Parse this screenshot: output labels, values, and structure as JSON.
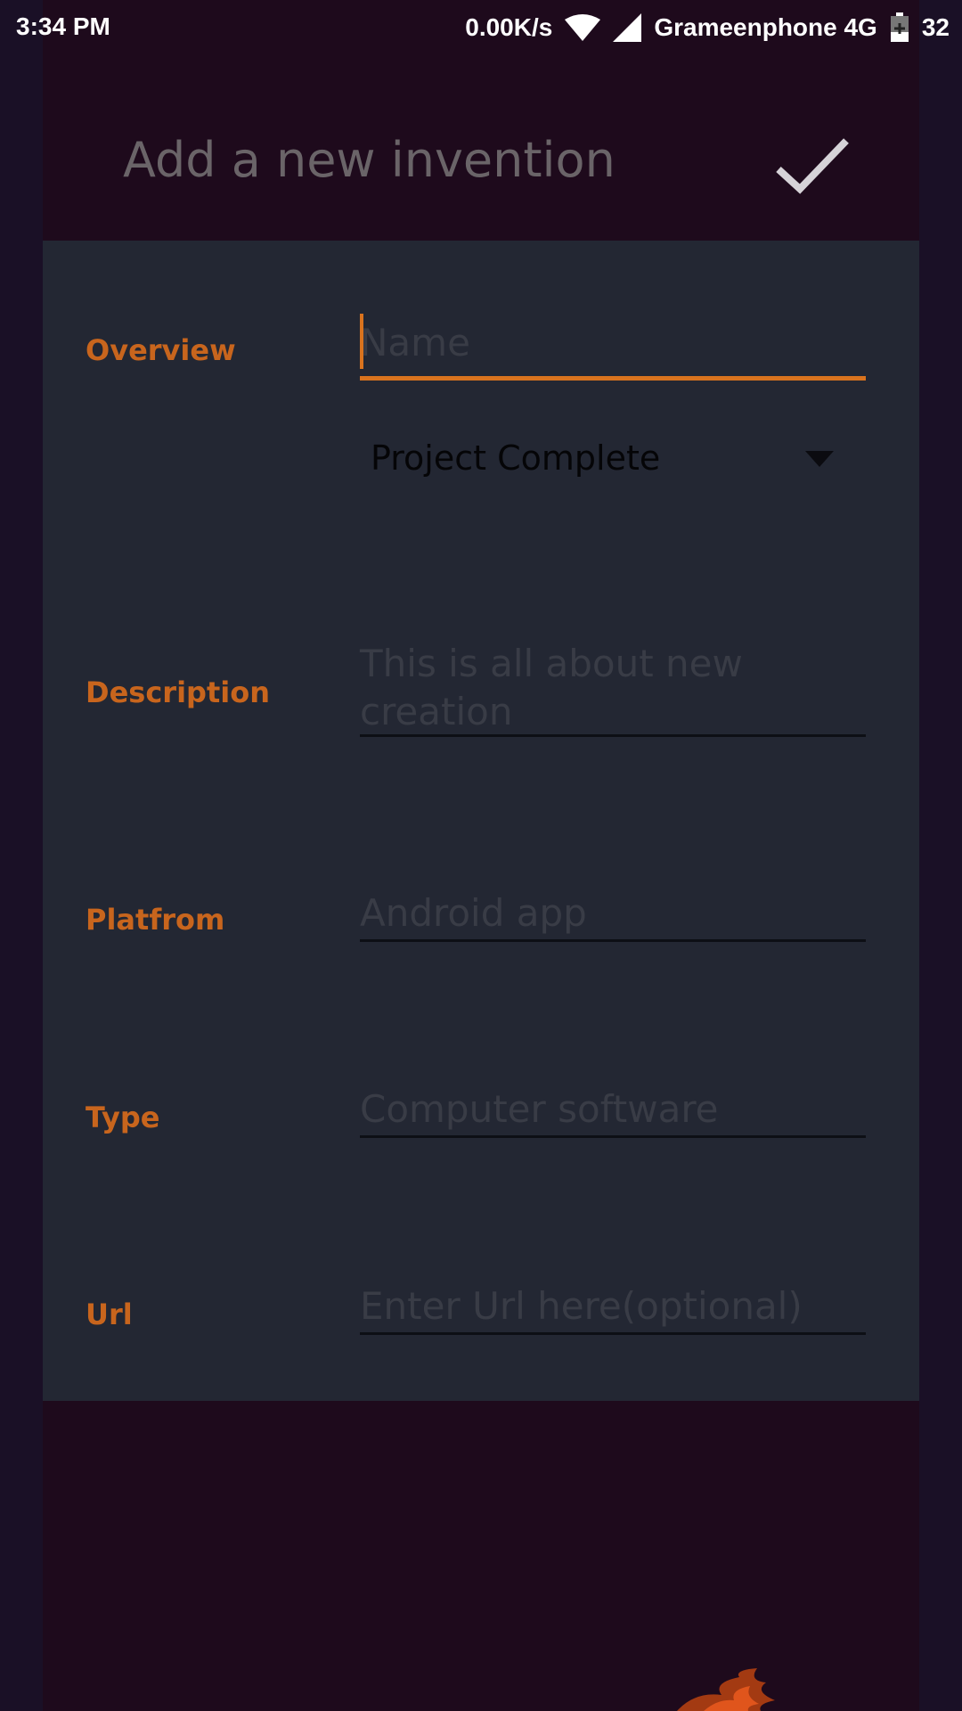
{
  "status_bar": {
    "time": "3:34 PM",
    "net_speed": "0.00K/s",
    "carrier": "Grameenphone 4G",
    "battery": "32"
  },
  "dialog": {
    "title": "Add a new invention",
    "confirm_icon": "checkmark-icon"
  },
  "form": {
    "overview_label": "Overview",
    "name_placeholder": "Name",
    "status_selected": "Project Complete",
    "description_label": "Description",
    "description_placeholder": "This is all about new\ncreation",
    "platform_label": "Platfrom",
    "platform_placeholder": "Android app",
    "type_label": "Type",
    "type_placeholder": "Computer software",
    "url_label": "Url",
    "url_placeholder": "Enter Url here(optional)"
  },
  "colors": {
    "accent": "#d9731e",
    "label": "#c8651d",
    "panel": "#232733",
    "header": "#1e0a1c"
  }
}
